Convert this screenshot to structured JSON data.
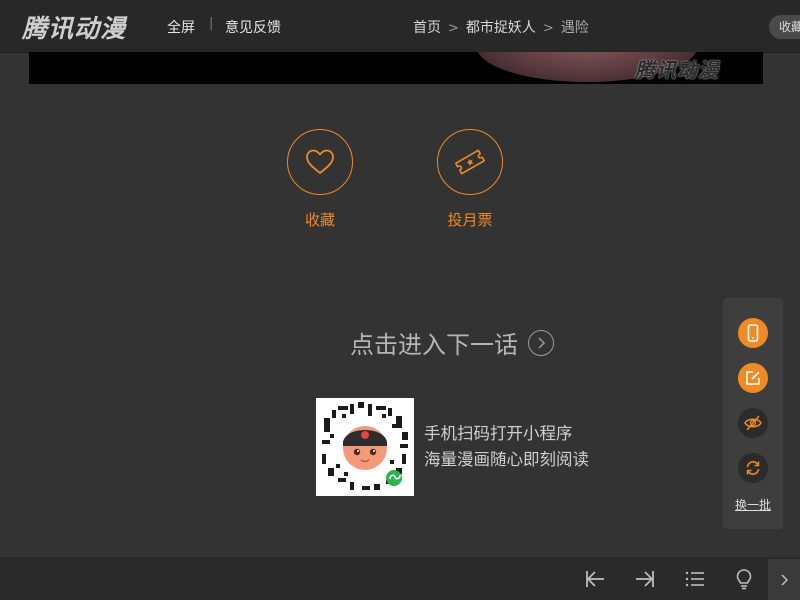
{
  "header": {
    "logo": "腾讯动漫",
    "fullscreen": "全屏",
    "separator": "|",
    "feedback": "意见反馈",
    "breadcrumb": {
      "home": "首页",
      "comic": "都市捉妖人",
      "chapter": "遇险",
      "sep": ">"
    },
    "collect": "收藏"
  },
  "comic": {
    "watermark": "腾讯动漫"
  },
  "actions": {
    "favorite": "收藏",
    "monthly_ticket": "投月票"
  },
  "next_chapter": {
    "label": "点击进入下一话"
  },
  "qr": {
    "line1": "手机扫码打开小程序",
    "line2": "海量漫画随心即刻阅读"
  },
  "side_panel": {
    "swap": "换一批"
  },
  "icons": [
    "phone-icon",
    "edit-icon",
    "hide-eye-icon",
    "refresh-icon",
    "prev-chapter-icon",
    "next-chapter-icon",
    "catalog-icon",
    "light-icon"
  ],
  "colors": {
    "accent": "#f08a24",
    "background": "#333333",
    "bar": "#282828"
  }
}
